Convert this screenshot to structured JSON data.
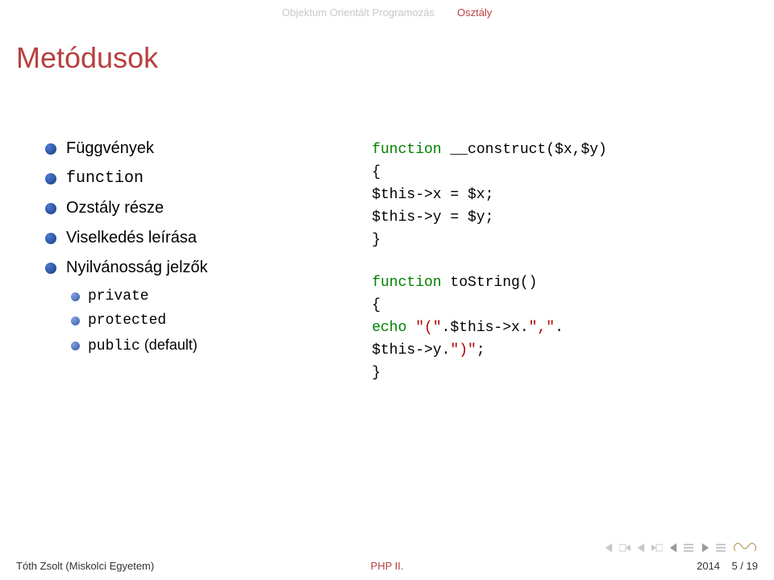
{
  "header": {
    "section1": "Objektum Orientált Programozás",
    "section2": "Osztály"
  },
  "title": "Metódusok",
  "bullets": {
    "b1": "Függvények",
    "b2_code": "function",
    "b3": "Ozstály része",
    "b4": "Viselkedés leírása",
    "b5": "Nyilvánosság jelzők",
    "sub1": "private",
    "sub2": "protected",
    "sub3_code": "public",
    "sub3_rest": " (default)"
  },
  "code": {
    "kw_function": "function",
    "construct": " __construct($x,$y)",
    "l_open": "{",
    "l_thisx": "$this->x = $x;",
    "l_thisy": "$this->y = $y;",
    "l_close": "}",
    "tostring": " toString()",
    "echo_kw": "echo",
    "echo_sp": " ",
    "str1": "\"(\"",
    "dot1": ".$this->x.",
    "str2": "\",\"",
    "dot2": ".",
    "l_thisyend": "$this->y.",
    "str3": "\")\"",
    "semi": ";"
  },
  "footer": {
    "left": "Tóth Zsolt (Miskolci Egyetem)",
    "center": "PHP II.",
    "right_year": "2014",
    "right_page": "5 / 19"
  }
}
